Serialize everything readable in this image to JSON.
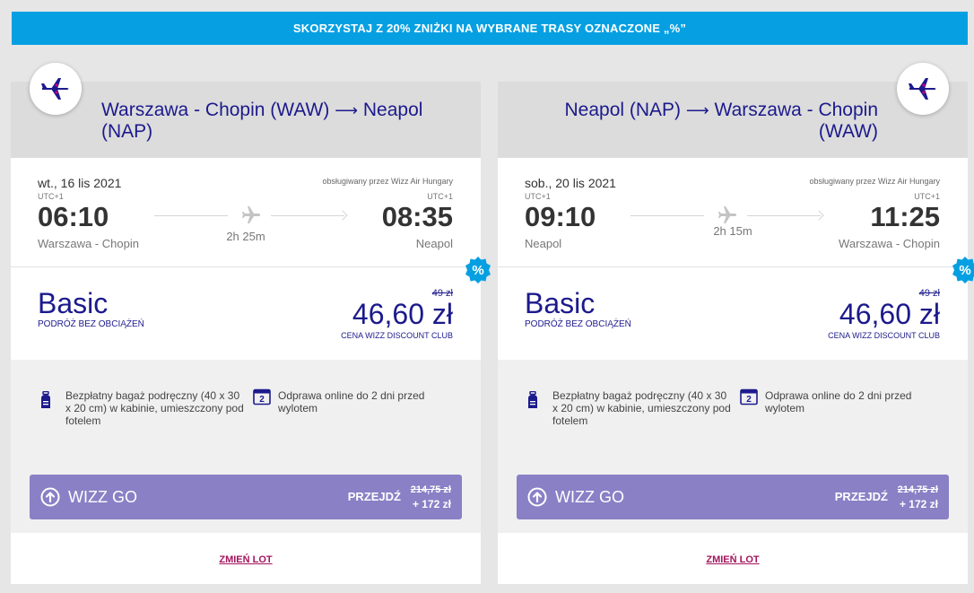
{
  "banner": {
    "text": "SKORZYSTAJ Z 20% ZNIŻKI NA WYBRANE TRASY OZNACZONE „%”"
  },
  "colors": {
    "brand": "#1c1a8c",
    "promo": "#06a0e2",
    "wizzgo": "#8a80c6",
    "link": "#a3145d"
  },
  "cards": [
    {
      "route": {
        "origin": "Warszawa - Chopin (WAW)",
        "arrow": "⟶",
        "destination": "Neapol (NAP)"
      },
      "flight": {
        "date": "wt., 16 lis 2021",
        "operated_by": "obsługiwany przez Wizz Air Hungary",
        "dep_tz": "UTC+1",
        "arr_tz": "UTC+1",
        "dep_time": "06:10",
        "arr_time": "08:35",
        "dep_city": "Warszawa - Chopin",
        "arr_city": "Neapol",
        "duration": "2h 25m"
      },
      "fare": {
        "name": "Basic",
        "subtitle": "PODRÓŻ BEZ OBCIĄŻEŃ",
        "old_price": "49 zł",
        "price": "46,60 zł",
        "club": "CENA WIZZ DISCOUNT CLUB",
        "badge": "%"
      },
      "features": {
        "baggage": "Bezpłatny bagaż podręczny (40 x 30 x 20 cm) w kabinie, umieszczony pod fotelem",
        "checkin_icon": "2",
        "checkin": "Odprawa online do 2 dni przed wylotem"
      },
      "wizzgo": {
        "label": "WIZZ GO",
        "action": "PRZEJDŹ",
        "old_price": "214,75 zł",
        "add_price": "+ 172 zł"
      },
      "change_link": "ZMIEŃ LOT"
    },
    {
      "route": {
        "origin": "Neapol (NAP)",
        "arrow": "⟶",
        "destination": "Warszawa - Chopin (WAW)"
      },
      "flight": {
        "date": "sob., 20 lis 2021",
        "operated_by": "obsługiwany przez Wizz Air Hungary",
        "dep_tz": "UTC+1",
        "arr_tz": "UTC+1",
        "dep_time": "09:10",
        "arr_time": "11:25",
        "dep_city": "Neapol",
        "arr_city": "Warszawa - Chopin",
        "duration": "2h 15m"
      },
      "fare": {
        "name": "Basic",
        "subtitle": "PODRÓŻ BEZ OBCIĄŻEŃ",
        "old_price": "49 zł",
        "price": "46,60 zł",
        "club": "CENA WIZZ DISCOUNT CLUB",
        "badge": "%"
      },
      "features": {
        "baggage": "Bezpłatny bagaż podręczny (40 x 30 x 20 cm) w kabinie, umieszczony pod fotelem",
        "checkin_icon": "2",
        "checkin": "Odprawa online do 2 dni przed wylotem"
      },
      "wizzgo": {
        "label": "WIZZ GO",
        "action": "PRZEJDŹ",
        "old_price": "214,75 zł",
        "add_price": "+ 172 zł"
      },
      "change_link": "ZMIEŃ LOT"
    }
  ],
  "icons": {
    "plane_badge": "airplane-icon",
    "baggage": "backpack-icon",
    "checkin": "calendar-icon",
    "wizzgo": "arrow-up-circle-icon"
  }
}
